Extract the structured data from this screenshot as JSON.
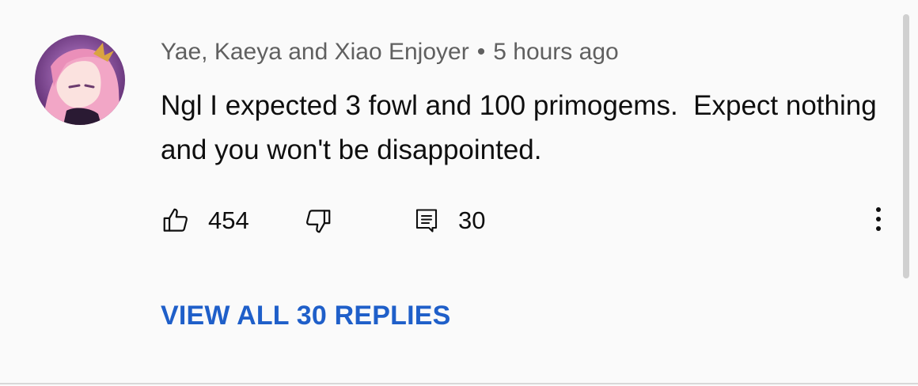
{
  "comment": {
    "author": "Yae, Kaeya and Xiao Enjoyer",
    "separator": "•",
    "timestamp": "5 hours ago",
    "text": "Ngl I expected 3 fowl and 100 primogems.  Expect nothing and you won't be disappointed.",
    "likes": "454",
    "replies_count": "30",
    "view_replies_label": "VIEW ALL 30 REPLIES"
  },
  "icons": {
    "like": "thumbs-up-icon",
    "dislike": "thumbs-down-icon",
    "reply": "reply-icon",
    "more": "more-vertical-icon"
  },
  "colors": {
    "link": "#1f5fc9",
    "meta_text": "#606060",
    "text": "#0f0f0f",
    "background": "#fafafa"
  }
}
